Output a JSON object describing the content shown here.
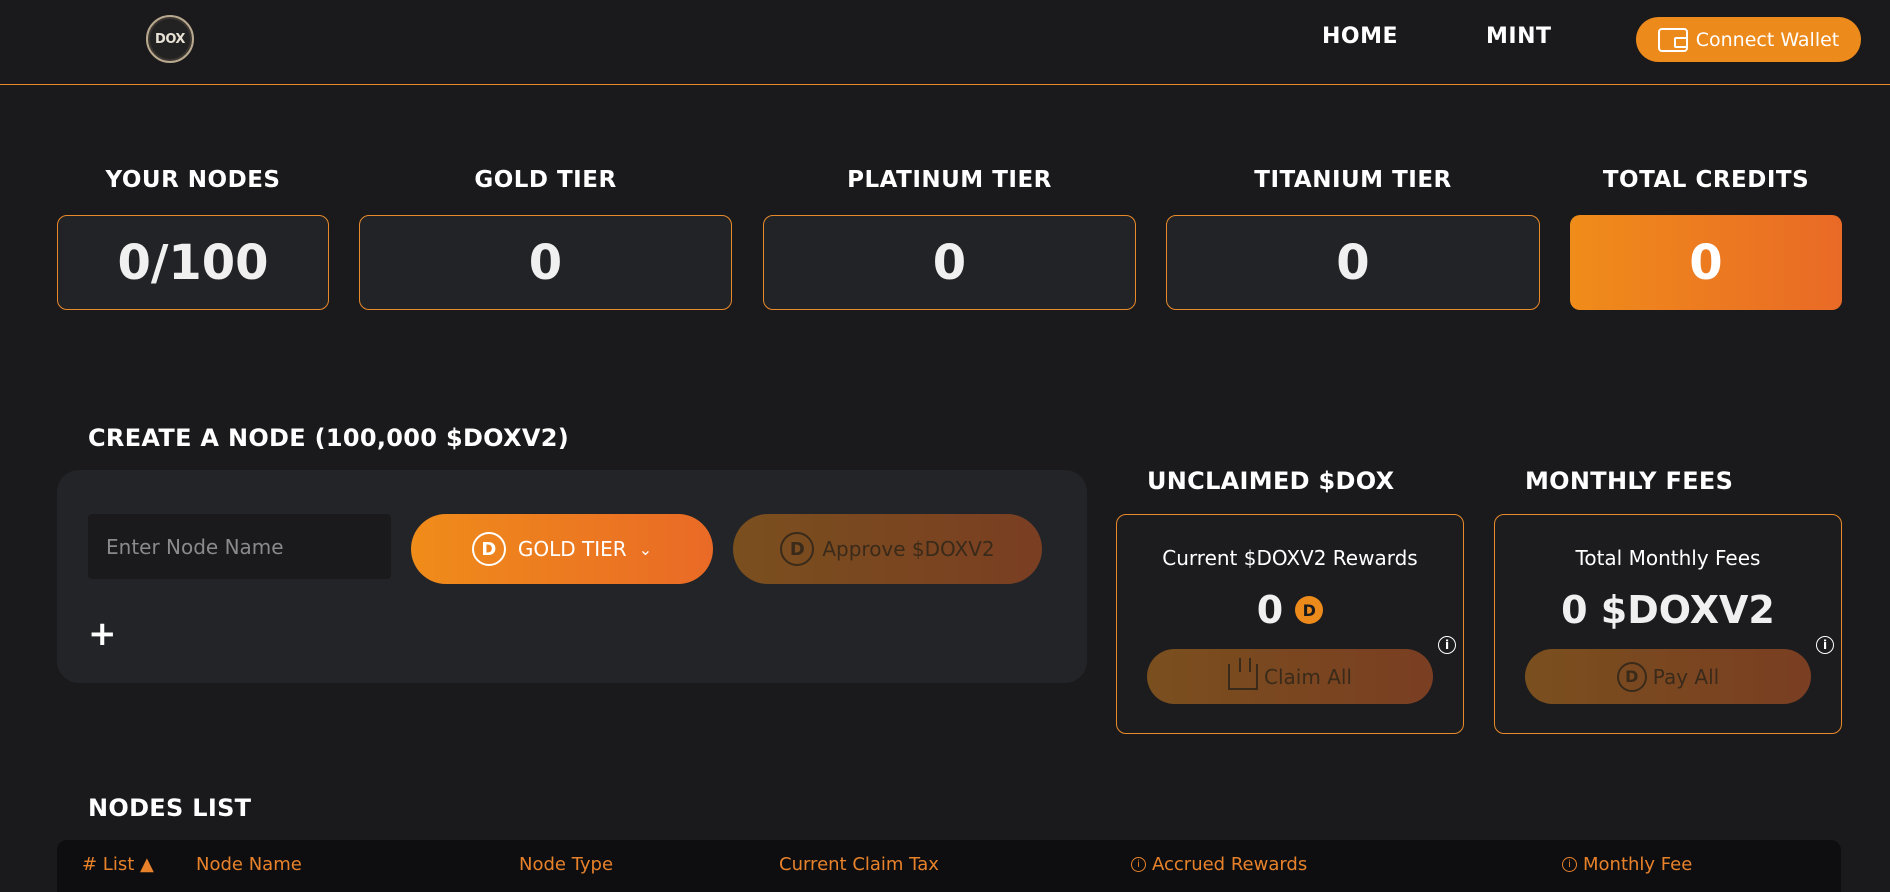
{
  "header": {
    "logo_text": "DOX",
    "nav": [
      {
        "label": "HOME"
      },
      {
        "label": "MINT"
      }
    ],
    "connect_label": "Connect Wallet"
  },
  "stats": [
    {
      "label": "YOUR NODES",
      "value": "0/100"
    },
    {
      "label": "GOLD TIER",
      "value": "0"
    },
    {
      "label": "PLATINUM TIER",
      "value": "0"
    },
    {
      "label": "TITANIUM TIER",
      "value": "0"
    },
    {
      "label": "TOTAL CREDITS",
      "value": "0"
    }
  ],
  "create": {
    "title": "CREATE A NODE (100,000 $DOXV2)",
    "input_placeholder": "Enter Node Name",
    "tier_label": "GOLD TIER",
    "tier_coin": "D",
    "approve_label": "Approve $DOXV2",
    "add_symbol": "+"
  },
  "unclaimed": {
    "title": "UNCLAIMED $DOX",
    "text": "Current $DOXV2 Rewards",
    "value": "0",
    "coin": "D",
    "button_label": "Claim All"
  },
  "fees": {
    "title": "MONTHLY FEES",
    "text": "Total Monthly Fees",
    "value": "0 $DOXV2",
    "button_label": "Pay All",
    "coin": "D"
  },
  "nodes_list": {
    "title": "NODES LIST",
    "columns": [
      "# List ▲",
      "Node Name",
      "Node Type",
      "Current Claim Tax",
      "Accrued Rewards",
      "Monthly Fee"
    ]
  },
  "colors": {
    "accent": "#ec8a1c",
    "accent_end": "#e96a26",
    "background": "#1a1a1c",
    "panel": "#232427"
  }
}
